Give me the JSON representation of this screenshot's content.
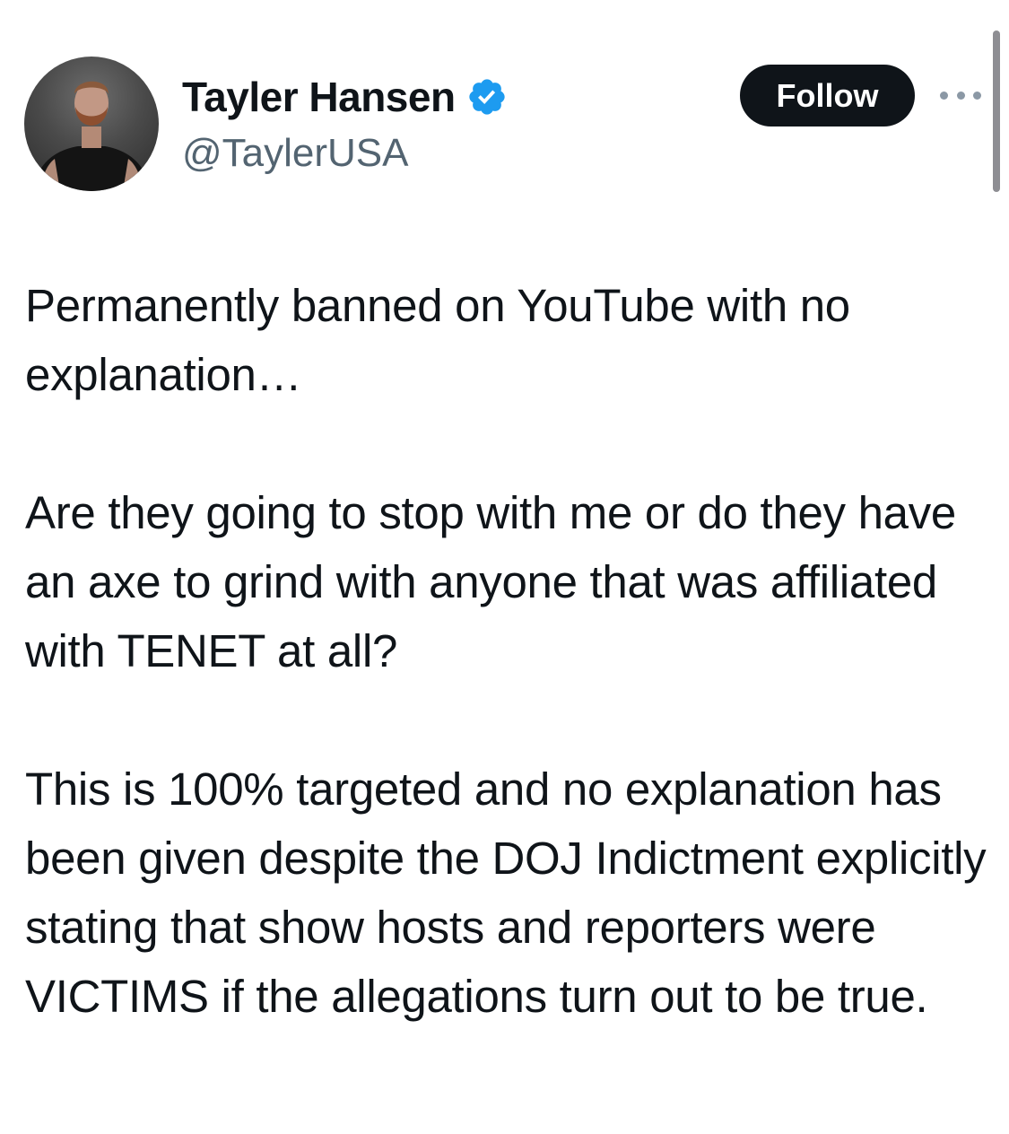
{
  "author": {
    "display_name": "Tayler Hansen",
    "handle": "@TaylerUSA",
    "verified": true,
    "avatar_icon": "profile-photo"
  },
  "actions": {
    "follow_label": "Follow",
    "more_icon": "more-horizontal-icon"
  },
  "tweet": {
    "paragraphs": [
      "Permanently banned on YouTube with no explanation…",
      "Are they going to stop with me or do they have an axe to grind with anyone that was affiliated with TENET at all?",
      "This is 100% targeted and no explanation has been given despite the DOJ Indictment explicitly stating that show hosts and reporters were VICTIMS if the allegations turn out to be true."
    ]
  },
  "colors": {
    "verified_badge": "#1d9bf0",
    "follow_button_bg": "#0f1419",
    "handle_text": "#536471"
  }
}
